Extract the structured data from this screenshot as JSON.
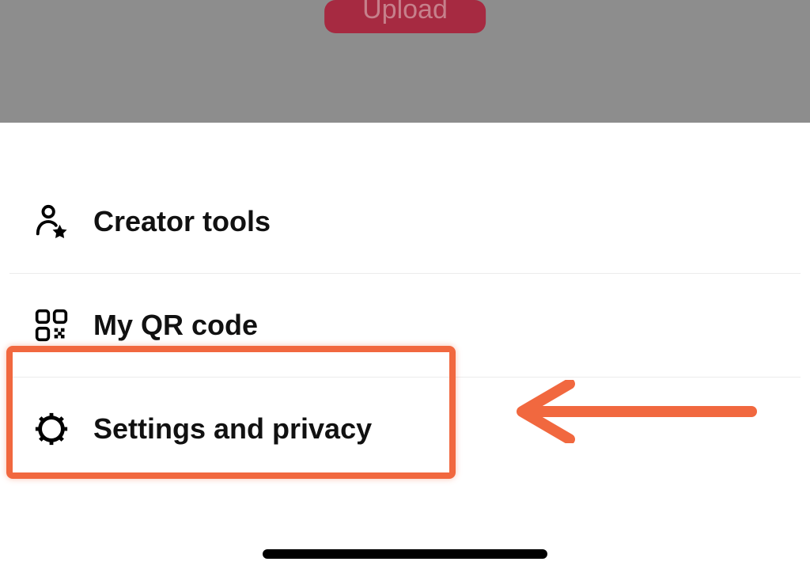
{
  "background": {
    "upload_label": "Upload"
  },
  "sheet": {
    "items": [
      {
        "label": "Creator tools",
        "icon": "person-star-icon"
      },
      {
        "label": "My QR code",
        "icon": "qr-code-icon"
      },
      {
        "label": "Settings and privacy",
        "icon": "gear-icon"
      }
    ]
  },
  "annotation": {
    "highlight_target": "Settings and privacy",
    "arrow_direction": "left",
    "color": "#f1683f"
  }
}
